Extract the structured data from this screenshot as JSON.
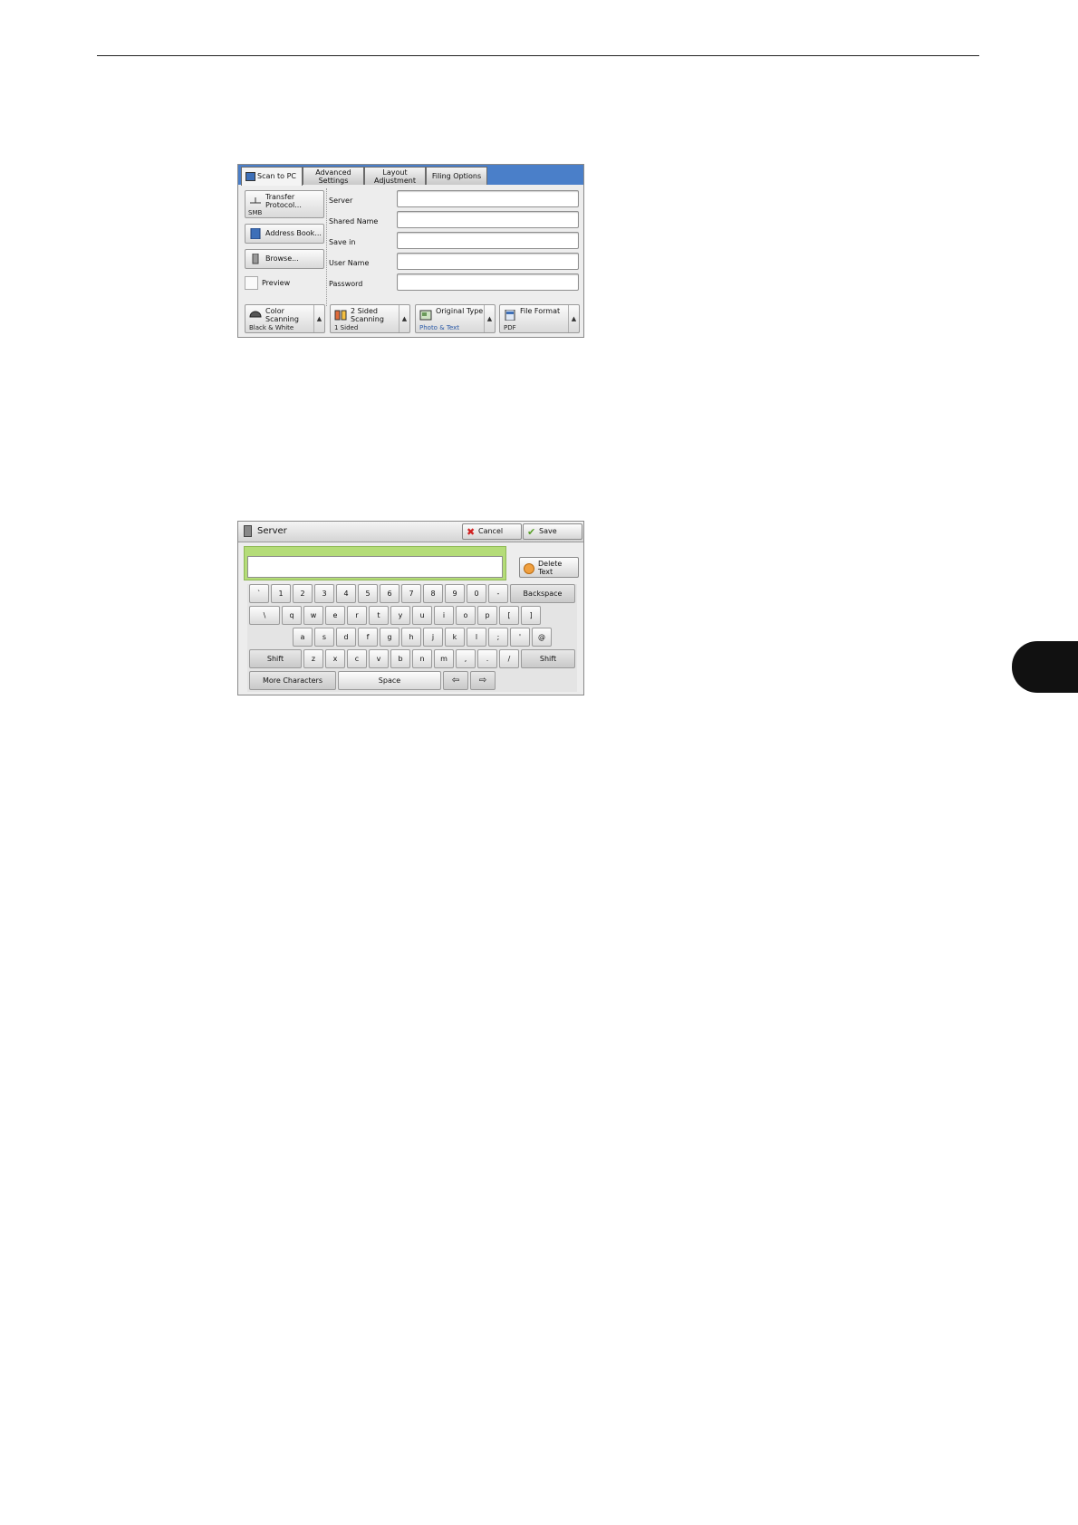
{
  "scan_panel": {
    "tabs": [
      "Scan to PC",
      "Advanced Settings",
      "Layout Adjustment",
      "Filing Options"
    ],
    "left_buttons": {
      "transfer_protocol": {
        "label": "Transfer Protocol...",
        "value": "SMB"
      },
      "address_book": {
        "label": "Address Book..."
      },
      "browse": {
        "label": "Browse..."
      },
      "preview": {
        "label": "Preview"
      }
    },
    "fields": {
      "server": {
        "label": "Server",
        "value": ""
      },
      "shared_name": {
        "label": "Shared Name",
        "value": ""
      },
      "save_in": {
        "label": "Save in",
        "value": ""
      },
      "user_name": {
        "label": "User Name",
        "value": ""
      },
      "password": {
        "label": "Password",
        "value": ""
      }
    },
    "bottom_buttons": {
      "color_scanning": {
        "label": "Color Scanning",
        "value": "Black & White"
      },
      "two_sided": {
        "label": "2 Sided Scanning",
        "value": "1 Sided"
      },
      "original_type": {
        "label": "Original Type",
        "value": "Photo & Text"
      },
      "file_format": {
        "label": "File Format",
        "value": "PDF"
      }
    },
    "colors": {
      "tabbar": "#4a7fc9",
      "accent_blue": "#2b5aa8"
    }
  },
  "keyboard_panel": {
    "title": "Server",
    "cancel_label": "Cancel",
    "save_label": "Save",
    "delete_text_label": "Delete Text",
    "input_value": "",
    "rows": {
      "row1": [
        "`",
        "1",
        "2",
        "3",
        "4",
        "5",
        "6",
        "7",
        "8",
        "9",
        "0",
        "-"
      ],
      "row2": [
        "\\",
        "q",
        "w",
        "e",
        "r",
        "t",
        "y",
        "u",
        "i",
        "o",
        "p",
        "[",
        "]"
      ],
      "row3": [
        "a",
        "s",
        "d",
        "f",
        "g",
        "h",
        "j",
        "k",
        "l",
        ";",
        "'",
        "@"
      ],
      "row4": [
        "z",
        "x",
        "c",
        "v",
        "b",
        "n",
        "m",
        ",",
        ".",
        "/"
      ]
    },
    "keys": {
      "backspace": "Backspace",
      "shift": "Shift",
      "more_characters": "More Characters",
      "space": "Space"
    },
    "colors": {
      "entry_highlight": "#b4dc78"
    }
  }
}
